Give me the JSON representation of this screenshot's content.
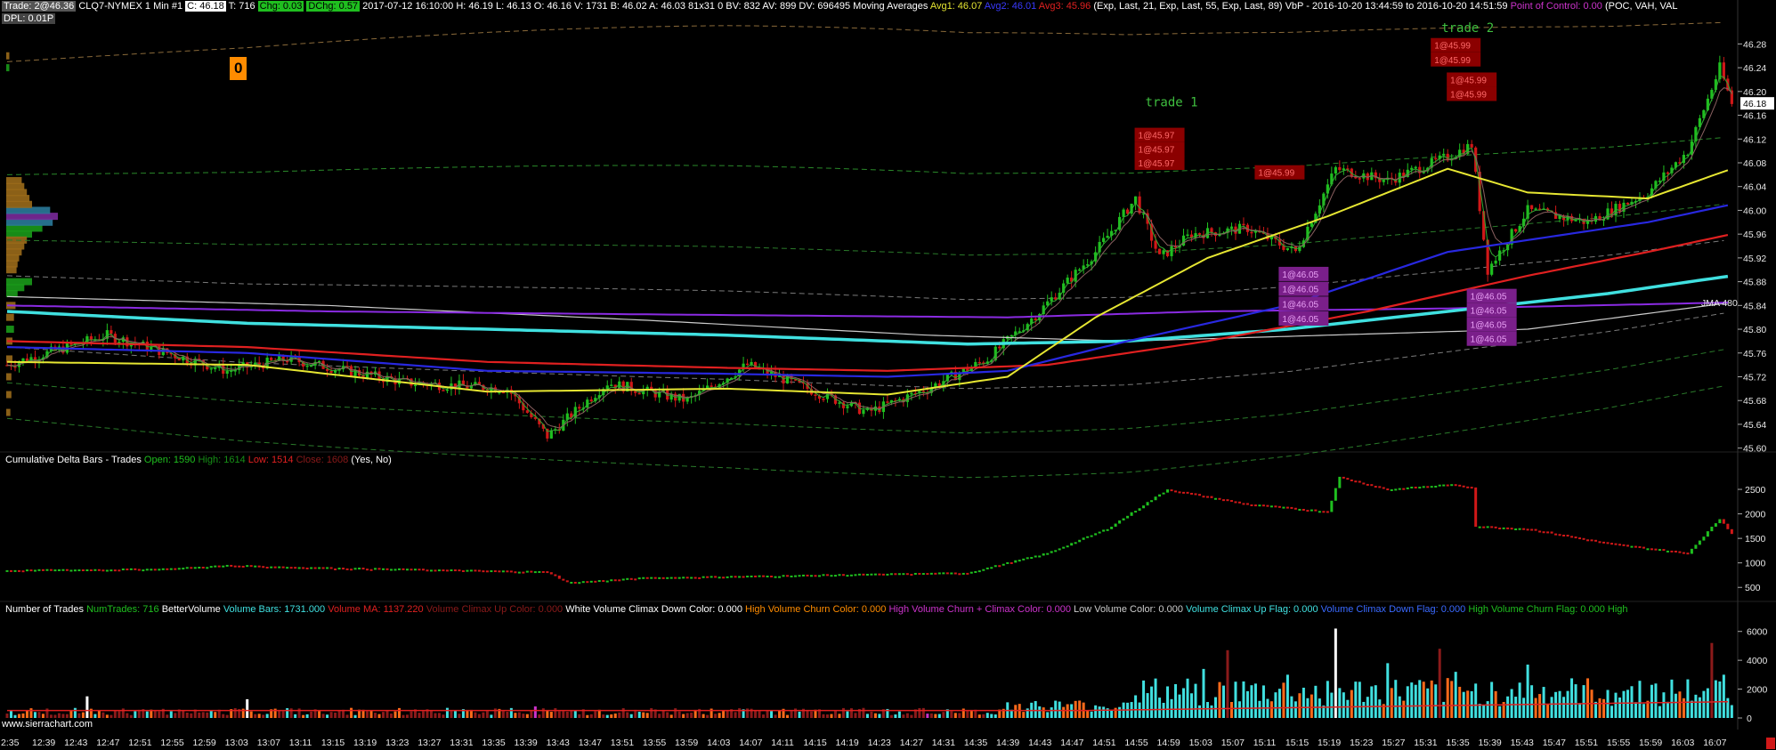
{
  "header": {
    "trade_box": "Trade: 2@46.36",
    "symbol": "CLQ7-NYMEX  1 Min   #1",
    "close_box": "C: 46.18",
    "trades": "T: 716",
    "chg_box": "Chg: 0.03",
    "dchg_box": "DChg: 0.57",
    "bar_info": "2017-07-12 16:10:00  H: 46.19  L: 46.13  O: 46.16  V: 1731  B: 46.02  A: 46.03  81x31  0  BV: 832  AV: 899  DV: 696495",
    "ma_title": "Moving Averages",
    "avg1": "Avg1: 46.07",
    "avg2": "Avg2: 46.01",
    "avg3": "Avg3: 45.96",
    "ma_params": "(Exp, Last, 21, Exp, Last, 55, Exp, Last, 89)",
    "vbp": "VbP - 2016-10-20  13:44:59 to 2016-10-20  14:51:59",
    "poc": "Point of Control: 0.00",
    "poc_params": "(POC, VAH, VAL",
    "dpl": "DPL: 0.01P",
    "zero_badge": "0"
  },
  "delta_header": {
    "title": "Cumulative Delta Bars - Trades",
    "open": "Open: 1590",
    "high": "High: 1614",
    "low": "Low: 1514",
    "close": "Close: 1608",
    "params": "(Yes, No)"
  },
  "volume_header": {
    "title": "Number of Trades",
    "numtrades": "NumTrades: 716",
    "bv": "BetterVolume",
    "vol_bars": "Volume Bars: 1731.000",
    "vol_ma": "Volume MA: 1137.220",
    "climax_up": "Volume Climax Up Color: 0.000",
    "climax_down": "White Volume Climax Down Color: 0.000",
    "churn": "High Volume Churn Color: 0.000",
    "churn_climax": "High Volume Churn + Climax Color: 0.000",
    "low_vol": "Low Volume Color: 0.000",
    "climax_up_flag": "Volume Climax Up Flag: 0.000",
    "climax_down_flag": "Volume Climax Down Flag: 0.000",
    "churn_flag": "High Volume Churn Flag: 0.000",
    "high_trunc": "High"
  },
  "footer": "www.sierrachart.com",
  "colors": {
    "up": "#1fbf1f",
    "down": "#d01818",
    "avg1": "#e6e632",
    "avg2": "#2828e0",
    "avg3": "#e02020",
    "cyan": "#40e0e0",
    "purple": "#8a2be2",
    "magenta": "#cc33cc"
  },
  "chart_data": [
    {
      "type": "candlestick",
      "title": "CLQ7-NYMEX 1 Min",
      "y_ticks": [
        "46.28",
        "46.24",
        "46.20",
        "46.16",
        "46.12",
        "46.08",
        "46.04",
        "46.00",
        "45.96",
        "45.92",
        "45.88",
        "45.84",
        "45.80",
        "45.76",
        "45.72",
        "45.68",
        "45.64",
        "45.60"
      ],
      "ylim": [
        45.595,
        46.315
      ],
      "last_price": "46.18",
      "ma_label": "JMA 480",
      "x_tick_labels": [
        "2:35",
        "12:39",
        "12:43",
        "12:47",
        "12:51",
        "12:55",
        "12:59",
        "13:03",
        "13:07",
        "13:11",
        "13:15",
        "13:19",
        "13:23",
        "13:27",
        "13:31",
        "13:35",
        "13:39",
        "13:43",
        "13:47",
        "13:51",
        "13:55",
        "13:59",
        "14:03",
        "14:07",
        "14:11",
        "14:15",
        "14:19",
        "14:23",
        "14:27",
        "14:31",
        "14:35",
        "14:39",
        "14:43",
        "14:47",
        "14:51",
        "14:55",
        "14:59",
        "15:03",
        "15:07",
        "15:11",
        "15:15",
        "15:19",
        "15:23",
        "15:27",
        "15:31",
        "15:35",
        "15:39",
        "15:43",
        "15:47",
        "15:51",
        "15:55",
        "15:59",
        "16:03",
        "16:07"
      ],
      "anchors": [
        [
          0,
          45.74
        ],
        [
          25,
          45.79
        ],
        [
          55,
          45.73
        ],
        [
          70,
          45.75
        ],
        [
          100,
          45.71
        ],
        [
          125,
          45.7
        ],
        [
          135,
          45.62
        ],
        [
          150,
          45.71
        ],
        [
          170,
          45.68
        ],
        [
          185,
          45.74
        ],
        [
          200,
          45.7
        ],
        [
          215,
          45.66
        ],
        [
          230,
          45.7
        ],
        [
          245,
          45.75
        ],
        [
          258,
          45.83
        ],
        [
          272,
          45.93
        ],
        [
          282,
          46.02
        ],
        [
          288,
          45.92
        ],
        [
          296,
          45.96
        ],
        [
          310,
          45.97
        ],
        [
          322,
          45.93
        ],
        [
          332,
          46.07
        ],
        [
          345,
          46.05
        ],
        [
          360,
          46.09
        ],
        [
          366,
          46.11
        ],
        [
          370,
          45.9
        ],
        [
          380,
          46.0
        ],
        [
          395,
          45.98
        ],
        [
          410,
          46.03
        ],
        [
          420,
          46.1
        ],
        [
          428,
          46.24
        ],
        [
          431,
          46.18
        ]
      ],
      "ema21": [
        [
          0,
          45.745
        ],
        [
          60,
          45.74
        ],
        [
          120,
          45.695
        ],
        [
          180,
          45.7
        ],
        [
          220,
          45.69
        ],
        [
          250,
          45.72
        ],
        [
          272,
          45.82
        ],
        [
          300,
          45.92
        ],
        [
          330,
          45.99
        ],
        [
          360,
          46.07
        ],
        [
          380,
          46.03
        ],
        [
          410,
          46.02
        ],
        [
          431,
          46.07
        ]
      ],
      "ema55": [
        [
          0,
          45.77
        ],
        [
          60,
          45.76
        ],
        [
          120,
          45.73
        ],
        [
          180,
          45.725
        ],
        [
          220,
          45.72
        ],
        [
          250,
          45.73
        ],
        [
          280,
          45.78
        ],
        [
          320,
          45.84
        ],
        [
          360,
          45.93
        ],
        [
          380,
          45.95
        ],
        [
          410,
          45.98
        ],
        [
          431,
          46.01
        ]
      ],
      "ema89": [
        [
          0,
          45.78
        ],
        [
          60,
          45.77
        ],
        [
          120,
          45.745
        ],
        [
          180,
          45.735
        ],
        [
          220,
          45.73
        ],
        [
          260,
          45.74
        ],
        [
          300,
          45.78
        ],
        [
          340,
          45.83
        ],
        [
          380,
          45.89
        ],
        [
          410,
          45.93
        ],
        [
          431,
          45.96
        ]
      ],
      "cyan_ma": [
        [
          0,
          45.83
        ],
        [
          60,
          45.81
        ],
        [
          120,
          45.8
        ],
        [
          180,
          45.79
        ],
        [
          240,
          45.775
        ],
        [
          280,
          45.78
        ],
        [
          320,
          45.8
        ],
        [
          360,
          45.83
        ],
        [
          400,
          45.86
        ],
        [
          431,
          45.89
        ]
      ],
      "purple_line": [
        [
          0,
          45.84
        ],
        [
          80,
          45.83
        ],
        [
          160,
          45.825
        ],
        [
          250,
          45.82
        ],
        [
          300,
          45.83
        ],
        [
          360,
          45.835
        ],
        [
          431,
          45.845
        ]
      ],
      "white_line": [
        [
          0,
          45.855
        ],
        [
          80,
          45.84
        ],
        [
          160,
          45.815
        ],
        [
          230,
          45.79
        ],
        [
          280,
          45.78
        ],
        [
          330,
          45.79
        ],
        [
          380,
          45.8
        ],
        [
          431,
          45.845
        ]
      ],
      "trade_labels": [
        {
          "text": "trade 1",
          "bar": 288,
          "price": 46.175
        },
        {
          "text": "trade 2",
          "bar": 362,
          "price": 46.3
        }
      ],
      "orders": [
        {
          "bar": 288,
          "price": 46.127,
          "text": "1@45.97"
        },
        {
          "bar": 288,
          "price": 46.103,
          "text": "1@45.97"
        },
        {
          "bar": 288,
          "price": 46.08,
          "text": "1@45.97"
        },
        {
          "bar": 318,
          "price": 46.064,
          "text": "1@45.99"
        },
        {
          "bar": 362,
          "price": 46.278,
          "text": "1@45.99"
        },
        {
          "bar": 362,
          "price": 46.254,
          "text": "1@45.99"
        },
        {
          "bar": 366,
          "price": 46.22,
          "text": "1@45.99"
        },
        {
          "bar": 366,
          "price": 46.196,
          "text": "1@45.99"
        },
        {
          "bar": 324,
          "price": 45.893,
          "text": "1@46.05"
        },
        {
          "bar": 324,
          "price": 45.868,
          "text": "1@46.05"
        },
        {
          "bar": 324,
          "price": 45.843,
          "text": "1@46.05"
        },
        {
          "bar": 324,
          "price": 45.818,
          "text": "1@46.05"
        },
        {
          "bar": 371,
          "price": 45.856,
          "text": "1@46.05"
        },
        {
          "bar": 371,
          "price": 45.832,
          "text": "1@46.05"
        },
        {
          "bar": 371,
          "price": 45.808,
          "text": "1@46.05"
        },
        {
          "bar": 371,
          "price": 45.784,
          "text": "1@46.05"
        }
      ]
    },
    {
      "type": "bar",
      "title": "Cumulative Delta Bars - Trades",
      "y_ticks": [
        "2500",
        "2000",
        "1500",
        "1000",
        "500"
      ],
      "ylim": [
        250,
        2900
      ],
      "anchors": [
        [
          0,
          850
        ],
        [
          40,
          880
        ],
        [
          55,
          950
        ],
        [
          80,
          900
        ],
        [
          135,
          820
        ],
        [
          140,
          600
        ],
        [
          160,
          700
        ],
        [
          200,
          750
        ],
        [
          240,
          800
        ],
        [
          260,
          1200
        ],
        [
          275,
          1700
        ],
        [
          290,
          2500
        ],
        [
          310,
          2200
        ],
        [
          330,
          2050
        ],
        [
          333,
          2750
        ],
        [
          345,
          2500
        ],
        [
          360,
          2600
        ],
        [
          366,
          2550
        ],
        [
          367,
          1750
        ],
        [
          380,
          1700
        ],
        [
          400,
          1400
        ],
        [
          420,
          1200
        ],
        [
          428,
          1900
        ],
        [
          431,
          1600
        ]
      ]
    },
    {
      "type": "bar",
      "title": "Number of Trades",
      "y_ticks": [
        "6000",
        "4000",
        "2000",
        "0"
      ],
      "ylim": [
        0,
        6600
      ],
      "volume_ma": 1137.22,
      "volume_bars": 1731
    }
  ]
}
